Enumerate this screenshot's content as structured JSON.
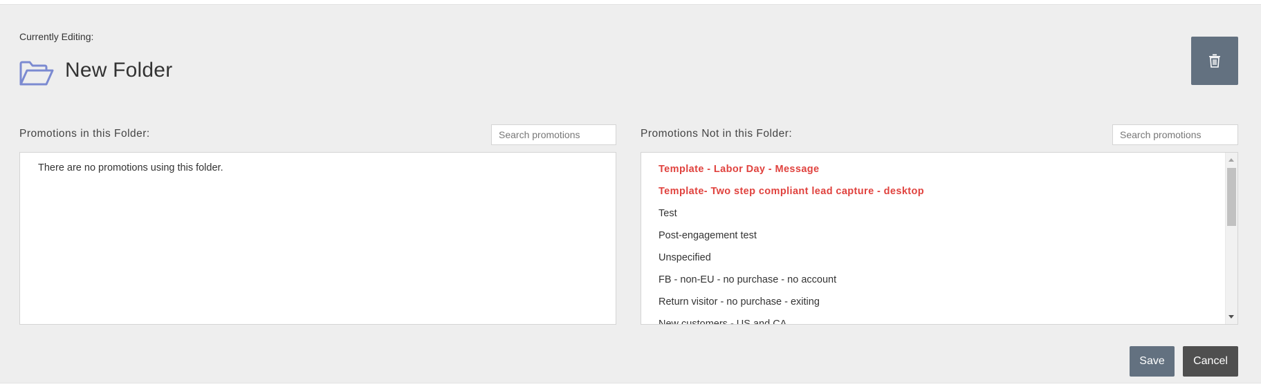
{
  "header": {
    "currently_editing_label": "Currently Editing:",
    "folder_name": "New Folder",
    "icon": "folder-open-icon",
    "delete_icon": "trash-icon"
  },
  "in_folder": {
    "label": "Promotions in this Folder:",
    "search_placeholder": "Search promotions",
    "empty_message": "There are no promotions using this folder."
  },
  "not_in_folder": {
    "label": "Promotions Not in this Folder:",
    "search_placeholder": "Search promotions",
    "items": [
      {
        "name": "Template - Labor Day - Message",
        "template": true
      },
      {
        "name": "Template- Two step compliant lead capture - desktop",
        "template": true
      },
      {
        "name": "Test",
        "template": false
      },
      {
        "name": "Post-engagement test",
        "template": false
      },
      {
        "name": "Unspecified",
        "template": false
      },
      {
        "name": "FB - non-EU - no purchase - no account",
        "template": false
      },
      {
        "name": "Return visitor - no purchase - exiting",
        "template": false
      },
      {
        "name": "New customers - US and CA",
        "template": false
      }
    ]
  },
  "actions": {
    "save_label": "Save",
    "cancel_label": "Cancel"
  },
  "colors": {
    "template_text": "#e0423e",
    "save_button": "#637180",
    "cancel_button": "#4f4f4f",
    "folder_icon": "#7b8ad1"
  }
}
